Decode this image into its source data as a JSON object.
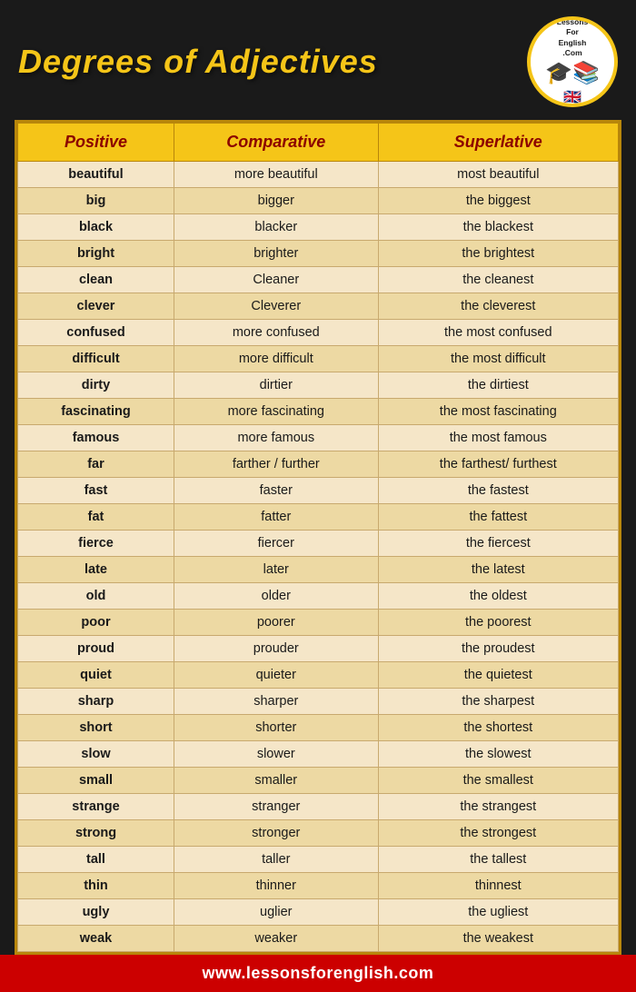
{
  "header": {
    "title": "Degrees of Adjectives",
    "logo_text_top": "LessonsForEnglish.Com",
    "logo_url_text": "www.lessonsforenglish.com"
  },
  "table": {
    "columns": [
      "Positive",
      "Comparative",
      "Superlative"
    ],
    "rows": [
      [
        "beautiful",
        "more beautiful",
        "most beautiful"
      ],
      [
        "big",
        "bigger",
        "the biggest"
      ],
      [
        "black",
        "blacker",
        "the blackest"
      ],
      [
        "bright",
        "brighter",
        "the brightest"
      ],
      [
        "clean",
        "Cleaner",
        "the cleanest"
      ],
      [
        "clever",
        "Cleverer",
        "the cleverest"
      ],
      [
        "confused",
        "more confused",
        "the most confused"
      ],
      [
        "difficult",
        "more difficult",
        "the most difficult"
      ],
      [
        "dirty",
        "dirtier",
        "the dirtiest"
      ],
      [
        "fascinating",
        "more fascinating",
        "the most fascinating"
      ],
      [
        "famous",
        "more famous",
        "the most famous"
      ],
      [
        "far",
        "farther / further",
        "the farthest/ furthest"
      ],
      [
        "fast",
        "faster",
        "the fastest"
      ],
      [
        "fat",
        "fatter",
        "the fattest"
      ],
      [
        "fierce",
        "fiercer",
        "the fiercest"
      ],
      [
        "late",
        "later",
        "the latest"
      ],
      [
        "old",
        "older",
        "the oldest"
      ],
      [
        "poor",
        "poorer",
        "the poorest"
      ],
      [
        "proud",
        "prouder",
        "the proudest"
      ],
      [
        "quiet",
        "quieter",
        "the quietest"
      ],
      [
        "sharp",
        "sharper",
        "the sharpest"
      ],
      [
        "short",
        "shorter",
        "the shortest"
      ],
      [
        "slow",
        "slower",
        "the slowest"
      ],
      [
        "small",
        "smaller",
        "the smallest"
      ],
      [
        "strange",
        "stranger",
        "the strangest"
      ],
      [
        "strong",
        "stronger",
        "the strongest"
      ],
      [
        "tall",
        "taller",
        "the tallest"
      ],
      [
        "thin",
        "thinner",
        "thinnest"
      ],
      [
        "ugly",
        "uglier",
        "the ugliest"
      ],
      [
        "weak",
        "weaker",
        "the weakest"
      ]
    ]
  },
  "footer": {
    "text": "www.lessonsforenglish.com"
  }
}
